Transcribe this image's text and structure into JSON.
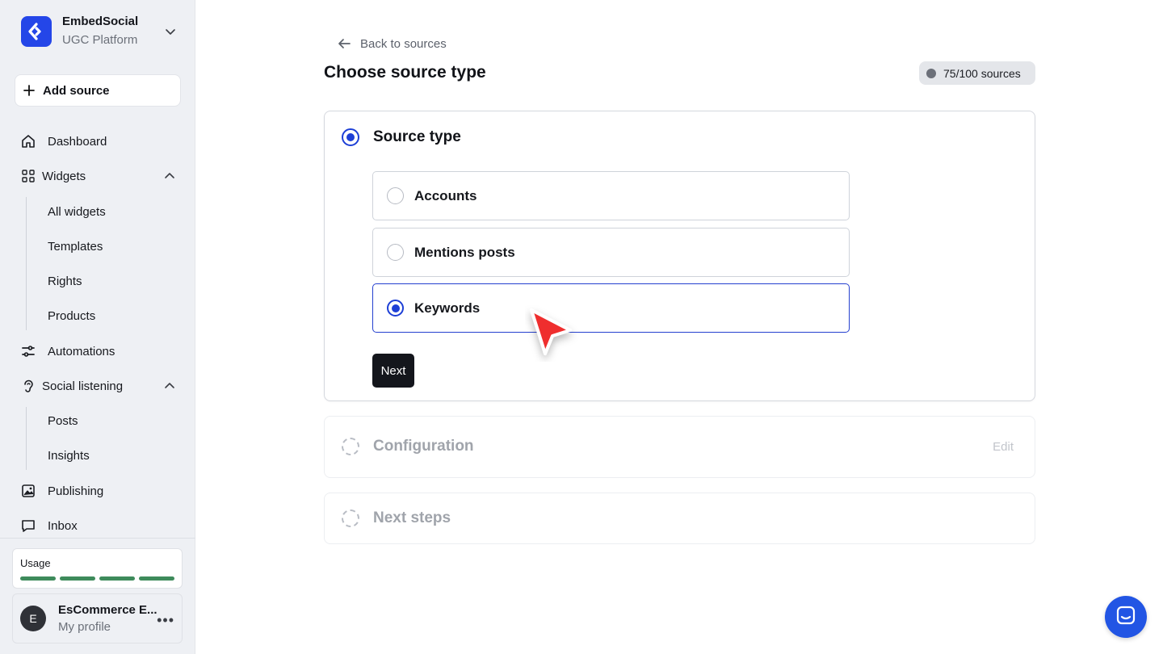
{
  "brand": {
    "name": "EmbedSocial",
    "subtitle": "UGC Platform"
  },
  "sidebar": {
    "add_source": "Add source",
    "items": {
      "dashboard": "Dashboard",
      "widgets": "Widgets",
      "all_widgets": "All widgets",
      "templates": "Templates",
      "rights": "Rights",
      "products": "Products",
      "automations": "Automations",
      "social_listening": "Social listening",
      "posts": "Posts",
      "insights": "Insights",
      "publishing": "Publishing",
      "inbox": "Inbox"
    },
    "usage": {
      "title": "Usage",
      "segments_filled": 4,
      "segments_total": 4,
      "color": "#3e8b5b"
    },
    "profile": {
      "initial": "E",
      "name": "EsCommerce E...",
      "subtitle": "My profile"
    }
  },
  "main": {
    "back_link": "Back to sources",
    "title": "Choose source type",
    "quota": "75/100 sources",
    "steps": [
      {
        "title": "Source type",
        "options": [
          "Accounts",
          "Mentions posts",
          "Keywords"
        ],
        "selected": "Keywords",
        "next_label": "Next"
      },
      {
        "title": "Configuration",
        "edit_label": "Edit"
      },
      {
        "title": "Next steps"
      }
    ]
  },
  "colors": {
    "accent": "#1d3fd6",
    "brand": "#2446e8",
    "chat": "#2255e4"
  },
  "icons": [
    "chevron-down-icon",
    "plus-icon",
    "home-icon",
    "grid-icon",
    "chevron-up-icon",
    "automation-icon",
    "ear-icon",
    "image-icon",
    "chat-bubble-icon",
    "arrow-left-icon",
    "more-icon",
    "cursor-icon",
    "messenger-icon"
  ]
}
